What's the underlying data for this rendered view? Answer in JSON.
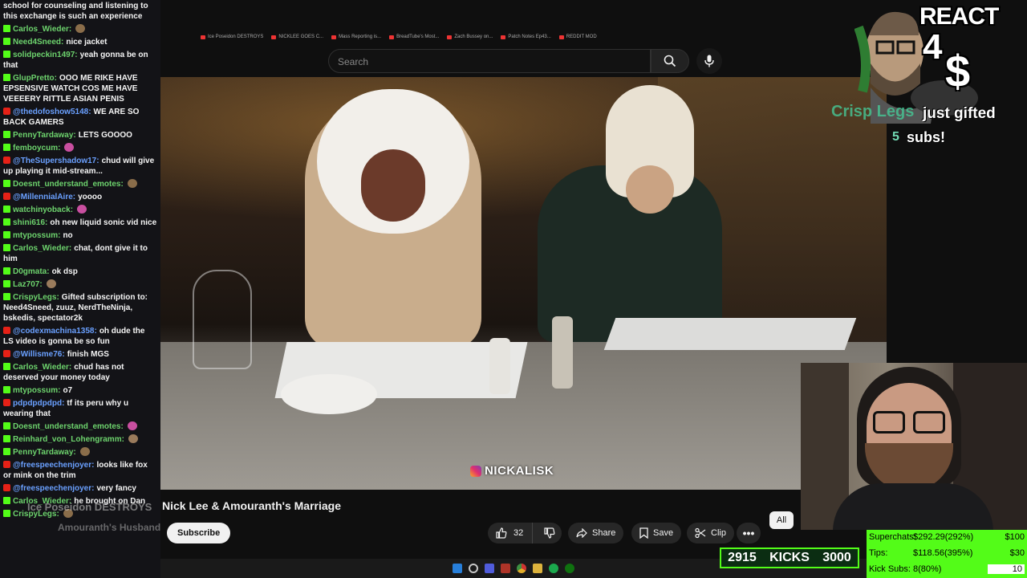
{
  "chat": {
    "top_line": "school for counseling and listening to this exchange is such an experience",
    "messages": [
      {
        "platform": "kick",
        "user": "Carlos_Wieder:",
        "text": ""
      },
      {
        "platform": "kick",
        "user": "Need4Sneed:",
        "text": "nice jacket"
      },
      {
        "platform": "kick",
        "user": "solidpeckin1497:",
        "text": "yeah gonna be on that"
      },
      {
        "platform": "kick",
        "user": "GlupPretto:",
        "text": "OOO ME RIKE HAVE EPSENSIVE WATCH COS ME HAVE VEEEERY RITTLE ASIAN PENIS"
      },
      {
        "platform": "yt",
        "user": "@thedofoshow5148:",
        "text": "WE ARE SO BACK GAMERS"
      },
      {
        "platform": "kick",
        "user": "PennyTardaway:",
        "text": "LETS GOOOO"
      },
      {
        "platform": "kick",
        "user": "femboycum:",
        "text": ""
      },
      {
        "platform": "yt",
        "user": "@TheSupershadow17:",
        "text": "chud will give up playing it mid-stream..."
      },
      {
        "platform": "kick",
        "user": "Doesnt_understand_emotes:",
        "text": ""
      },
      {
        "platform": "yt",
        "user": "@MillennialAire:",
        "text": "yoooo"
      },
      {
        "platform": "kick",
        "user": "watchinyoback:",
        "text": ""
      },
      {
        "platform": "kick",
        "user": "shini616:",
        "text": "oh new liquid sonic vid nice"
      },
      {
        "platform": "kick",
        "user": "mtypossum:",
        "text": "no"
      },
      {
        "platform": "kick",
        "user": "Carlos_Wieder:",
        "text": "chat, dont give it to him"
      },
      {
        "platform": "kick",
        "user": "D0gmata:",
        "text": "ok dsp"
      },
      {
        "platform": "kick",
        "user": "Laz707:",
        "text": ""
      },
      {
        "platform": "kick",
        "user": "CrispyLegs:",
        "text": "Gifted subscription to: Need4Sneed, zuuz, NerdTheNinja, bskedis, spectator2k"
      },
      {
        "platform": "yt",
        "user": "@codexmachina1358:",
        "text": "oh dude the LS video is gonna be so fun"
      },
      {
        "platform": "yt",
        "user": "@Willisme76:",
        "text": "finish MGS"
      },
      {
        "platform": "kick",
        "user": "Carlos_Wieder:",
        "text": "chud has not deserved your money today"
      },
      {
        "platform": "kick",
        "user": "mtypossum:",
        "text": "o7"
      },
      {
        "platform": "yt",
        "user": "pdpdpdpdpd:",
        "text": "tf its peru why u wearing that"
      },
      {
        "platform": "kick",
        "user": "Doesnt_understand_emotes:",
        "text": ""
      },
      {
        "platform": "kick",
        "user": "Reinhard_von_Lohengramm:",
        "text": ""
      },
      {
        "platform": "kick",
        "user": "PennyTardaway:",
        "text": ""
      },
      {
        "platform": "yt",
        "user": "@freespeechenjoyer:",
        "text": "looks like fox or mink on the trim"
      },
      {
        "platform": "yt",
        "user": "@freespeechenjoyer:",
        "text": "very fancy"
      },
      {
        "platform": "kick",
        "user": "Carlos_Wieder:",
        "text": "he brought on Dan"
      },
      {
        "platform": "kick",
        "user": "CrispyLegs:",
        "text": ""
      }
    ]
  },
  "bookmarks": [
    "Ice Poseidon DESTROYS",
    "NICKLEE GOES C...",
    "Mass Reporting is...",
    "BreadTube's Most...",
    "Zach Bussey on...",
    "Patch Notes Ep43...",
    "REDDIT MOD"
  ],
  "search": {
    "placeholder": "Search"
  },
  "video": {
    "watermark": "NICKALISK",
    "title": "Nick Lee & Amouranth's Marriage",
    "channel_overlay": "Ice Poseidon DESTROYS",
    "channel_name": "Amouranth's Husband"
  },
  "actions": {
    "subscribe": "Subscribe",
    "like_count": "32",
    "share": "Share",
    "save": "Save",
    "clip": "Clip",
    "more": "•••",
    "chip_all": "All"
  },
  "react_overlay": {
    "line1": "REACT",
    "line2": "4",
    "line3": "$",
    "alert_name": "Crisp Legs",
    "alert_text": "just gifted",
    "alert_count": "5",
    "alert_subs": "subs!"
  },
  "kicks": {
    "current": "2915",
    "label": "KICKS",
    "goal": "3000"
  },
  "stats": {
    "rows": [
      {
        "label": "Superchats:",
        "value": "$292.29(292%)",
        "goal": "$100"
      },
      {
        "label": "Tips:",
        "value": "$118.56(395%)",
        "goal": "$30"
      },
      {
        "label": "Kick Subs:",
        "value": "8(80%)",
        "goal": "10"
      }
    ]
  },
  "colors": {
    "kick_green": "#53fc18",
    "yt_red": "#e62117",
    "bg": "#0f0f0f"
  }
}
